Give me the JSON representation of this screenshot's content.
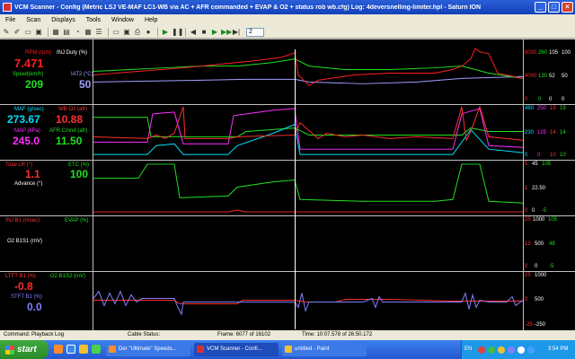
{
  "window": {
    "title": "VCM Scanner  -  Config  (Metric LSJ VE-MAF LC1-WB via AC + AFR commanded + EVAP & O2 + status rob wb.cfg)   Log:  4deversnelling-limiter.hpl   -   Saturn ION",
    "minimize": "_",
    "maximize": "□",
    "close": "×"
  },
  "menu": [
    "File",
    "Scan",
    "Displays",
    "Tools",
    "Window",
    "Help"
  ],
  "toolbar": {
    "spin_value": "2"
  },
  "colors": {
    "rpm": "#ff2020",
    "speed": "#20e020",
    "iat": "#a0a0ff",
    "maf": "#00e0ff",
    "wb": "#ff3030",
    "map": "#ff30ff",
    "afr": "#20e020",
    "timing": "#ff3030",
    "etc": "#20e020",
    "ltft": "#ff3030",
    "stft": "#8080ff"
  },
  "panels": [
    {
      "gauges": [
        {
          "label": "RPM (rpm)",
          "value": "7.471",
          "color": "#ff2020"
        },
        {
          "label": "INJ Duty (%)",
          "value": "",
          "color": "#ffffff"
        },
        {
          "label": "Speed(km/h)",
          "value": "209",
          "color": "#20e020"
        },
        {
          "label": "IAT2 (°C)",
          "value": "50",
          "color": "#a0a0ff"
        }
      ],
      "scale": [
        {
          "text": "8000",
          "color": "#ff2020"
        },
        {
          "text": "260",
          "color": "#20e020"
        },
        {
          "text": "105",
          "color": "#ffffff"
        },
        {
          "text": "100",
          "color": "#ffffff"
        },
        {
          "text": "4000",
          "color": "#ff2020"
        },
        {
          "text": "130",
          "color": "#20e020"
        },
        {
          "text": "52",
          "color": "#ffffff"
        },
        {
          "text": "50",
          "color": "#ffffff"
        },
        {
          "text": "0",
          "color": "#ff2020"
        },
        {
          "text": "0",
          "color": "#20e020"
        },
        {
          "text": "0",
          "color": "#ffffff"
        },
        {
          "text": "0",
          "color": "#ffffff"
        }
      ]
    },
    {
      "gauges": [
        {
          "label": "MAF (g/sec)",
          "value": "273.67",
          "color": "#00e0ff"
        },
        {
          "label": "WB O2 (afr)",
          "value": "10.88",
          "color": "#ff3030"
        },
        {
          "label": "MAP (kPa)",
          "value": "245.0",
          "color": "#ff30ff"
        },
        {
          "label": "AFR Cmnd (afr)",
          "value": "11.50",
          "color": "#20e020"
        }
      ],
      "scale": [
        {
          "text": "460",
          "color": "#00e0ff"
        },
        {
          "text": "250",
          "color": "#ff30ff"
        },
        {
          "text": "19",
          "color": "#ff3030"
        },
        {
          "text": "19",
          "color": "#20e020"
        },
        {
          "text": "230",
          "color": "#00e0ff"
        },
        {
          "text": "125",
          "color": "#ff30ff"
        },
        {
          "text": "14",
          "color": "#ff3030"
        },
        {
          "text": "14",
          "color": "#20e020"
        },
        {
          "text": "0",
          "color": "#00e0ff"
        },
        {
          "text": "0",
          "color": "#ff30ff"
        },
        {
          "text": "10",
          "color": "#ff3030"
        },
        {
          "text": "10",
          "color": "#20e020"
        }
      ]
    },
    {
      "gauges": [
        {
          "label": "Total LR (°)",
          "value": "1.1",
          "color": "#ff3030"
        },
        {
          "label": "ETC (%)",
          "value": "100",
          "color": "#20e020"
        },
        {
          "label": "Advance (°)",
          "value": "",
          "color": "#ffffff"
        }
      ],
      "scale": [
        {
          "text": "5",
          "color": "#ff3030"
        },
        {
          "text": "45",
          "color": "#ffffff"
        },
        {
          "text": "105",
          "color": "#20e020"
        },
        {
          "text": "1",
          "color": "#ff3030"
        },
        {
          "text": "22.50",
          "color": "#ffffff"
        },
        {
          "text": "0",
          "color": "#ff3030"
        },
        {
          "text": "0",
          "color": "#ffffff"
        },
        {
          "text": "-5",
          "color": "#20e020"
        }
      ]
    },
    {
      "gauges": [
        {
          "label": "INJ B1 (msec)",
          "value": "",
          "color": "#ff3030"
        },
        {
          "label": "EVAP (%)",
          "value": "",
          "color": "#20e020"
        },
        {
          "label": "O2 B1S1 (mV)",
          "value": "",
          "color": "#ffffff"
        }
      ],
      "scale": [
        {
          "text": "25",
          "color": "#ff3030"
        },
        {
          "text": "1000",
          "color": "#ffffff"
        },
        {
          "text": "105",
          "color": "#20e020"
        },
        {
          "text": "12",
          "color": "#ff3030"
        },
        {
          "text": "500",
          "color": "#ffffff"
        },
        {
          "text": "48",
          "color": "#20e020"
        },
        {
          "text": "0",
          "color": "#ff3030"
        },
        {
          "text": "0",
          "color": "#ffffff"
        },
        {
          "text": "-5",
          "color": "#20e020"
        }
      ]
    },
    {
      "gauges": [
        {
          "label": "LTFT B1 (%)",
          "value": "-0.8",
          "color": "#ff3030"
        },
        {
          "label": "O2 B1S2 (mV)",
          "value": "",
          "color": "#20e020"
        },
        {
          "label": "STFT B1 (%)",
          "value": "0.0",
          "color": "#8080ff"
        }
      ],
      "scale": [
        {
          "text": "25",
          "color": "#ff3030"
        },
        {
          "text": "1000",
          "color": "#ffffff"
        },
        {
          "text": "0",
          "color": "#ff3030"
        },
        {
          "text": "500",
          "color": "#ffffff"
        },
        {
          "text": "-25",
          "color": "#ff3030"
        },
        {
          "text": "-250",
          "color": "#ffffff"
        }
      ]
    }
  ],
  "status": {
    "command": "Command:  Playback Log",
    "cable": "Cable Status:",
    "frame": "Frame:  6077 of 16102",
    "time": "Time:  10:07.578 of 26:50.172"
  },
  "taskbar": {
    "start": "start",
    "tasks": [
      "Der \"Ultimate\" Speeds...",
      "VCM Scanner  -  Confi...",
      "untitled - Paint"
    ],
    "lang": "EN",
    "clock": "3:54 PM"
  }
}
